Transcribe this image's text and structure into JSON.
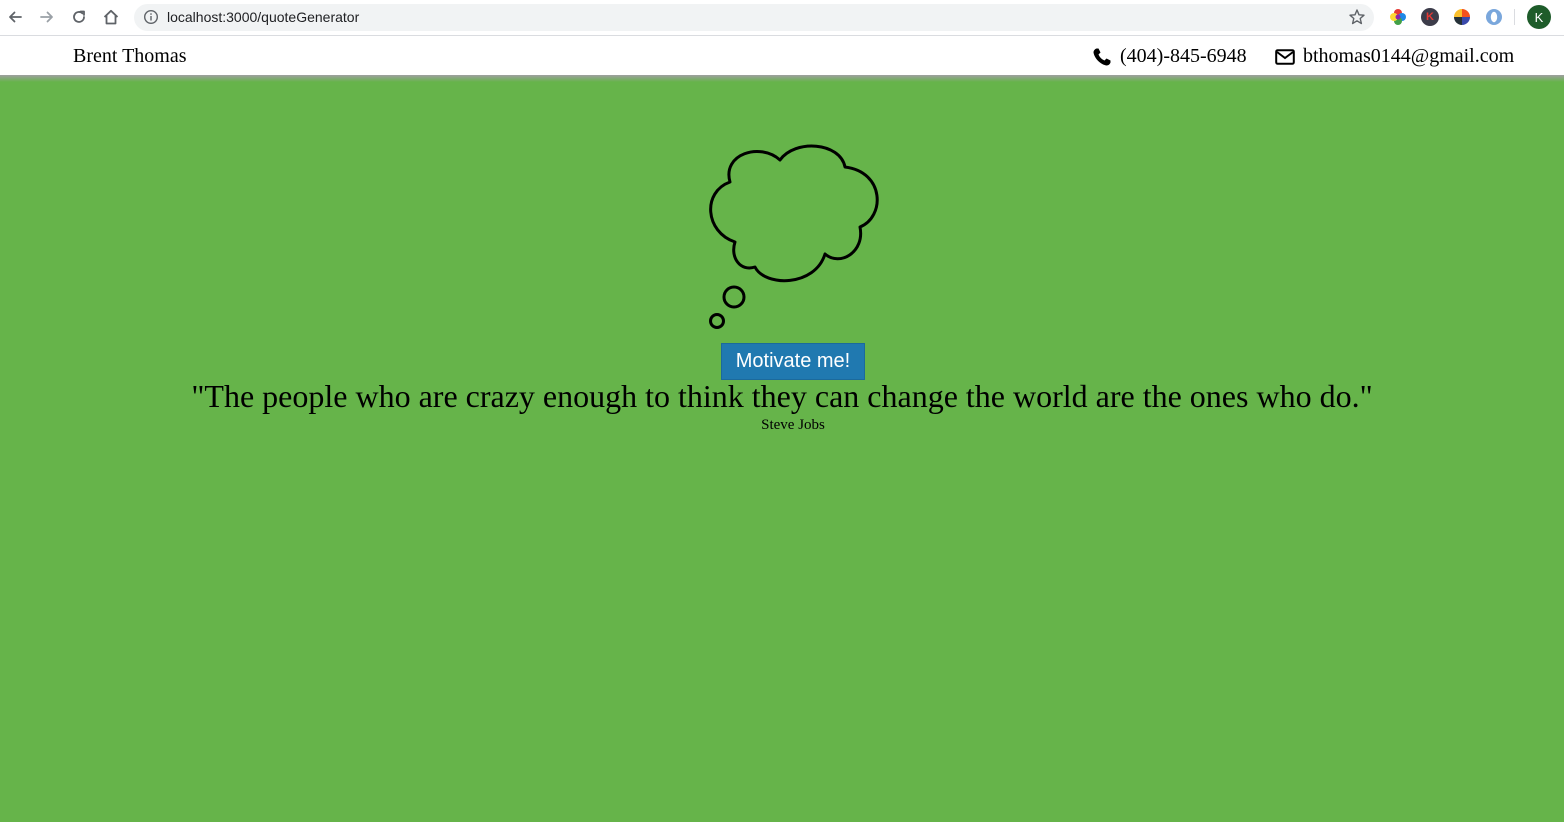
{
  "browser": {
    "url": "localhost:3000/quoteGenerator",
    "profile_initial": "K",
    "extensions": [
      "color-wheel-extension-icon",
      "k-extension-icon",
      "s-extension-icon",
      "o-extension-icon"
    ]
  },
  "header": {
    "name": "Brent Thomas",
    "phone": "(404)-845-6948",
    "email": "bthomas0144@gmail.com"
  },
  "main": {
    "button_label": "Motivate me!",
    "quote": "\"The people who are crazy enough to think they can change the world are the ones who do.\"",
    "author": "Steve Jobs"
  },
  "colors": {
    "background": "#66b44a",
    "button": "#2079b0"
  }
}
